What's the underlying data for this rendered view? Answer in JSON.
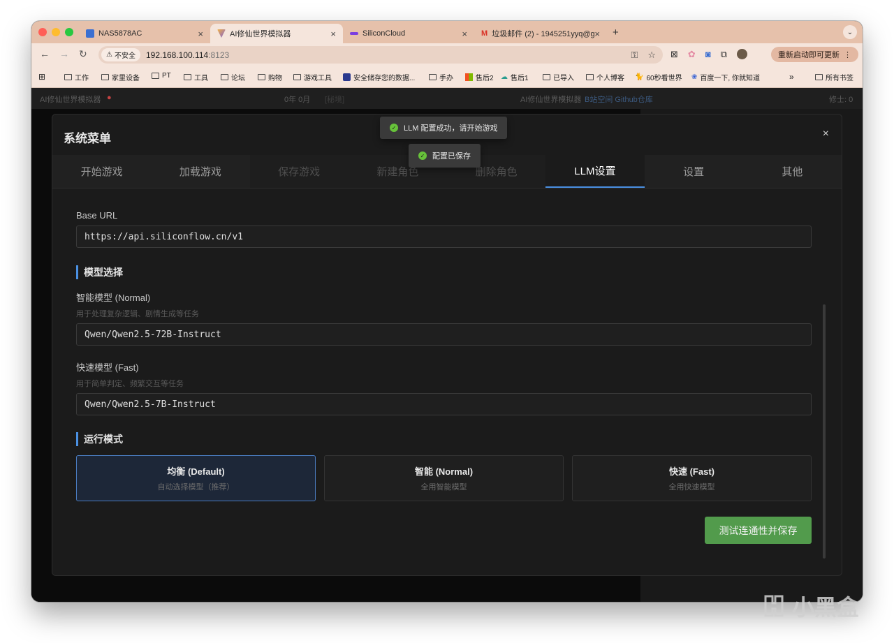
{
  "browser": {
    "tabs": [
      {
        "title": "NAS5878AC",
        "favicon_color": "#3b6fd1"
      },
      {
        "title": "AI修仙世界模拟器",
        "favicon_color": "#7b5bd6"
      },
      {
        "title": "SiliconCloud",
        "favicon_color": "#7b3fe0"
      },
      {
        "title": "垃圾邮件 (2) - 1945251yyq@g",
        "favicon_color": "#d93025"
      }
    ],
    "secure_label": "不安全",
    "url_host": "192.168.100.114",
    "url_port": ":8123",
    "update_button": "重新启动即可更新",
    "bookmarks": [
      "工作",
      "家里设备",
      "PT",
      "工具",
      "论坛",
      "购物",
      "游戏工具",
      "安全储存您的数据...",
      "手办",
      "售后2",
      "售后1",
      "已导入",
      "个人博客",
      "60秒看世界",
      "百度一下, 你就知道",
      "所有书签"
    ]
  },
  "appbar": {
    "title": "AI修仙世界模拟器",
    "date": "0年 0月",
    "location": "[秘境]",
    "link_prefix": "AI修仙世界模拟器",
    "links": "B站空间 Github仓库",
    "cultivator": "修士: 0"
  },
  "toasts": {
    "llm_success": "LLM 配置成功，请开始游戏",
    "saved": "配置已保存"
  },
  "modal": {
    "title": "系统菜单",
    "close": "×",
    "tabs": [
      "开始游戏",
      "加载游戏",
      "保存游戏",
      "新建角色",
      "删除角色",
      "LLM设置",
      "设置",
      "其他"
    ],
    "base_url_label": "Base URL",
    "base_url_value": "https://api.siliconflow.cn/v1",
    "model_section": "模型选择",
    "normal_label": "智能模型 (Normal)",
    "normal_hint": "用于处理复杂逻辑、剧情生成等任务",
    "normal_value": "Qwen/Qwen2.5-72B-Instruct",
    "fast_label": "快速模型 (Fast)",
    "fast_hint": "用于简单判定、频繁交互等任务",
    "fast_value": "Qwen/Qwen2.5-7B-Instruct",
    "mode_section": "运行模式",
    "modes": [
      {
        "name": "均衡 (Default)",
        "desc": "自动选择模型（推荐）"
      },
      {
        "name": "智能 (Normal)",
        "desc": "全用智能模型"
      },
      {
        "name": "快速 (Fast)",
        "desc": "全用快速模型"
      }
    ],
    "save_button": "测试连通性并保存"
  },
  "watermark": "小黑盒"
}
